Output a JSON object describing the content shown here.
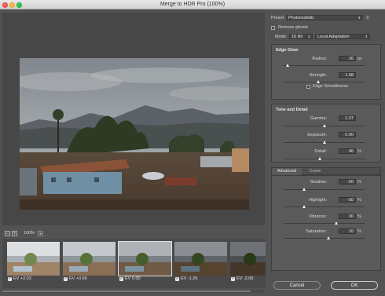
{
  "window": {
    "title": "Merge to HDR Pro (100%)"
  },
  "zoom": {
    "out_symbol": "−",
    "in_symbol": "+",
    "value": "100%"
  },
  "filmstrip": [
    {
      "label": "EV +2.03",
      "checked": true
    },
    {
      "label": "EV +0.66",
      "checked": true
    },
    {
      "label": "EV 0.00",
      "checked": true
    },
    {
      "label": "EV -1.26",
      "checked": true
    },
    {
      "label": "EV -2.06",
      "checked": true
    }
  ],
  "right": {
    "preset_label": "Preset:",
    "preset_value": "Photorealistic",
    "remove_ghosts_label": "Remove ghosts",
    "remove_ghosts_checked": false,
    "mode_label": "Mode:",
    "bit_value": "16 Bit",
    "method_value": "Local Adaptation",
    "edge_glow": {
      "title": "Edge Glow",
      "radius_label": "Radius:",
      "radius_value": "26",
      "radius_unit": "px",
      "radius_pos": 0.05,
      "strength_label": "Strength:",
      "strength_value": "1.68",
      "strength_pos": 0.43,
      "edge_smooth_label": "Edge Smoothness",
      "edge_smooth_checked": false
    },
    "tone": {
      "title": "Tone and Detail",
      "gamma_label": "Gamma:",
      "gamma_value": "1.27",
      "gamma_pos": 0.5,
      "exposure_label": "Exposure:",
      "exposure_value": "0.00",
      "exposure_pos": 0.5,
      "detail_label": "Detail:",
      "detail_value": "46",
      "detail_unit": "%",
      "detail_pos": 0.45
    },
    "tabs": {
      "advanced": "Advanced",
      "curve": "Curve"
    },
    "advanced": {
      "shadow_label": "Shadow:",
      "shadow_value": "-50",
      "shadow_unit": "%",
      "shadow_pos": 0.25,
      "highlight_label": "Highlight:",
      "highlight_value": "-50",
      "highlight_unit": "%",
      "highlight_pos": 0.25,
      "vibrance_label": "Vibrance:",
      "vibrance_value": "30",
      "vibrance_unit": "%",
      "vibrance_pos": 0.65,
      "saturation_label": "Saturation:",
      "saturation_value": "10",
      "saturation_unit": "%",
      "saturation_pos": 0.55
    },
    "cancel_label": "Cancel",
    "ok_label": "OK"
  }
}
